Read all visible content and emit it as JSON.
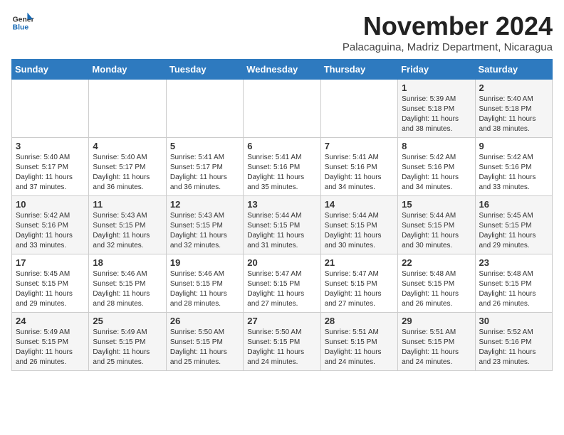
{
  "logo": {
    "general": "General",
    "blue": "Blue"
  },
  "header": {
    "month": "November 2024",
    "location": "Palacaguina, Madriz Department, Nicaragua"
  },
  "days_of_week": [
    "Sunday",
    "Monday",
    "Tuesday",
    "Wednesday",
    "Thursday",
    "Friday",
    "Saturday"
  ],
  "weeks": [
    [
      {
        "day": "",
        "info": ""
      },
      {
        "day": "",
        "info": ""
      },
      {
        "day": "",
        "info": ""
      },
      {
        "day": "",
        "info": ""
      },
      {
        "day": "",
        "info": ""
      },
      {
        "day": "1",
        "info": "Sunrise: 5:39 AM\nSunset: 5:18 PM\nDaylight: 11 hours\nand 38 minutes."
      },
      {
        "day": "2",
        "info": "Sunrise: 5:40 AM\nSunset: 5:18 PM\nDaylight: 11 hours\nand 38 minutes."
      }
    ],
    [
      {
        "day": "3",
        "info": "Sunrise: 5:40 AM\nSunset: 5:17 PM\nDaylight: 11 hours\nand 37 minutes."
      },
      {
        "day": "4",
        "info": "Sunrise: 5:40 AM\nSunset: 5:17 PM\nDaylight: 11 hours\nand 36 minutes."
      },
      {
        "day": "5",
        "info": "Sunrise: 5:41 AM\nSunset: 5:17 PM\nDaylight: 11 hours\nand 36 minutes."
      },
      {
        "day": "6",
        "info": "Sunrise: 5:41 AM\nSunset: 5:16 PM\nDaylight: 11 hours\nand 35 minutes."
      },
      {
        "day": "7",
        "info": "Sunrise: 5:41 AM\nSunset: 5:16 PM\nDaylight: 11 hours\nand 34 minutes."
      },
      {
        "day": "8",
        "info": "Sunrise: 5:42 AM\nSunset: 5:16 PM\nDaylight: 11 hours\nand 34 minutes."
      },
      {
        "day": "9",
        "info": "Sunrise: 5:42 AM\nSunset: 5:16 PM\nDaylight: 11 hours\nand 33 minutes."
      }
    ],
    [
      {
        "day": "10",
        "info": "Sunrise: 5:42 AM\nSunset: 5:16 PM\nDaylight: 11 hours\nand 33 minutes."
      },
      {
        "day": "11",
        "info": "Sunrise: 5:43 AM\nSunset: 5:15 PM\nDaylight: 11 hours\nand 32 minutes."
      },
      {
        "day": "12",
        "info": "Sunrise: 5:43 AM\nSunset: 5:15 PM\nDaylight: 11 hours\nand 32 minutes."
      },
      {
        "day": "13",
        "info": "Sunrise: 5:44 AM\nSunset: 5:15 PM\nDaylight: 11 hours\nand 31 minutes."
      },
      {
        "day": "14",
        "info": "Sunrise: 5:44 AM\nSunset: 5:15 PM\nDaylight: 11 hours\nand 30 minutes."
      },
      {
        "day": "15",
        "info": "Sunrise: 5:44 AM\nSunset: 5:15 PM\nDaylight: 11 hours\nand 30 minutes."
      },
      {
        "day": "16",
        "info": "Sunrise: 5:45 AM\nSunset: 5:15 PM\nDaylight: 11 hours\nand 29 minutes."
      }
    ],
    [
      {
        "day": "17",
        "info": "Sunrise: 5:45 AM\nSunset: 5:15 PM\nDaylight: 11 hours\nand 29 minutes."
      },
      {
        "day": "18",
        "info": "Sunrise: 5:46 AM\nSunset: 5:15 PM\nDaylight: 11 hours\nand 28 minutes."
      },
      {
        "day": "19",
        "info": "Sunrise: 5:46 AM\nSunset: 5:15 PM\nDaylight: 11 hours\nand 28 minutes."
      },
      {
        "day": "20",
        "info": "Sunrise: 5:47 AM\nSunset: 5:15 PM\nDaylight: 11 hours\nand 27 minutes."
      },
      {
        "day": "21",
        "info": "Sunrise: 5:47 AM\nSunset: 5:15 PM\nDaylight: 11 hours\nand 27 minutes."
      },
      {
        "day": "22",
        "info": "Sunrise: 5:48 AM\nSunset: 5:15 PM\nDaylight: 11 hours\nand 26 minutes."
      },
      {
        "day": "23",
        "info": "Sunrise: 5:48 AM\nSunset: 5:15 PM\nDaylight: 11 hours\nand 26 minutes."
      }
    ],
    [
      {
        "day": "24",
        "info": "Sunrise: 5:49 AM\nSunset: 5:15 PM\nDaylight: 11 hours\nand 26 minutes."
      },
      {
        "day": "25",
        "info": "Sunrise: 5:49 AM\nSunset: 5:15 PM\nDaylight: 11 hours\nand 25 minutes."
      },
      {
        "day": "26",
        "info": "Sunrise: 5:50 AM\nSunset: 5:15 PM\nDaylight: 11 hours\nand 25 minutes."
      },
      {
        "day": "27",
        "info": "Sunrise: 5:50 AM\nSunset: 5:15 PM\nDaylight: 11 hours\nand 24 minutes."
      },
      {
        "day": "28",
        "info": "Sunrise: 5:51 AM\nSunset: 5:15 PM\nDaylight: 11 hours\nand 24 minutes."
      },
      {
        "day": "29",
        "info": "Sunrise: 5:51 AM\nSunset: 5:15 PM\nDaylight: 11 hours\nand 24 minutes."
      },
      {
        "day": "30",
        "info": "Sunrise: 5:52 AM\nSunset: 5:16 PM\nDaylight: 11 hours\nand 23 minutes."
      }
    ]
  ]
}
